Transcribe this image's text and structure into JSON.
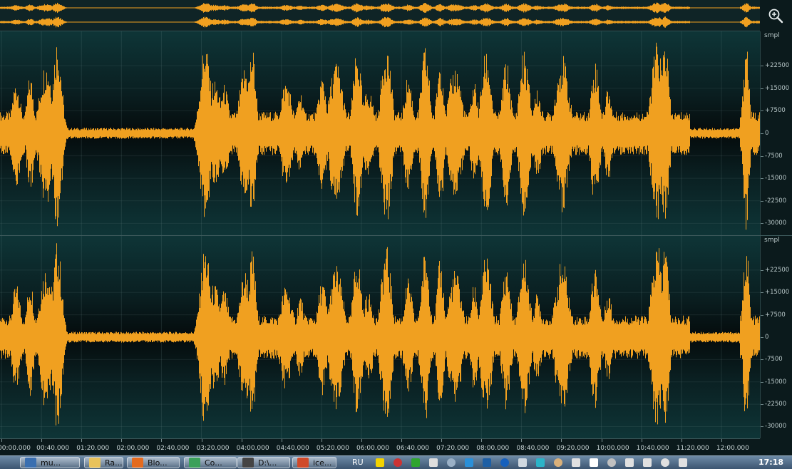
{
  "app": {
    "overview_icon": "zoom-in-icon",
    "amplitude_unit": "smpl",
    "waveform_color": "#f0a020",
    "amplitude_ticks": [
      "+22500",
      "+15000",
      "+7500",
      "0",
      "-7500",
      "-15000",
      "-22500",
      "-30000"
    ],
    "amplitude_values": [
      22500,
      15000,
      7500,
      0,
      -7500,
      -15000,
      -22500,
      -30000
    ],
    "amplitude_range": [
      -33000,
      33000
    ],
    "time_labels": [
      "00:00.000",
      "00:40.000",
      "01:20.000",
      "02:00.000",
      "02:40.000",
      "03:20.000",
      "04:00.000",
      "04:40.000",
      "05:20.000",
      "06:00.000",
      "06:40.000",
      "07:20.000",
      "08:00.000",
      "08:40.000",
      "09:20.000",
      "10:00.000",
      "10:40.000",
      "11:20.000",
      "12:00.000"
    ],
    "time_seconds": [
      0,
      40,
      80,
      120,
      160,
      200,
      240,
      280,
      320,
      360,
      400,
      440,
      480,
      520,
      560,
      600,
      640,
      680,
      720
    ],
    "duration_seconds": 753
  },
  "taskbar": {
    "buttons": [
      {
        "label": "mu...",
        "icon": "window-icon",
        "color": "#3a6fb0"
      },
      {
        "label": "Ra...",
        "icon": "folder-icon",
        "color": "#e8c25a"
      },
      {
        "label": "Blo...",
        "icon": "firefox-icon",
        "color": "#e46b1f"
      },
      {
        "label": "Co...",
        "icon": "chrome-icon",
        "color": "#3aa05a"
      },
      {
        "label": "D:\\...",
        "icon": "terminal-icon",
        "color": "#444444"
      },
      {
        "label": "ice...",
        "icon": "home-icon",
        "color": "#d04a2a"
      }
    ],
    "language": "RU",
    "tray_icons": [
      {
        "icon": "shield-icon",
        "color": "#f2d200"
      },
      {
        "icon": "pen-icon",
        "color": "#cc3333"
      },
      {
        "icon": "arrow-icon",
        "color": "#2fa52f"
      },
      {
        "icon": "gear-icon",
        "color": "#dddddd"
      },
      {
        "icon": "screen-icon",
        "color": "#9ab0c6"
      },
      {
        "icon": "s-icon",
        "color": "#2a8fd8"
      },
      {
        "icon": "bars-icon",
        "color": "#1d5fa5"
      },
      {
        "icon": "v-icon",
        "color": "#1560bd"
      },
      {
        "icon": "grid-icon",
        "color": "#cfd8e0"
      },
      {
        "icon": "chat-icon",
        "color": "#2bb3c8"
      },
      {
        "icon": "hand-icon",
        "color": "#d9b07a"
      },
      {
        "icon": "search-icon",
        "color": "#e0e0e0"
      },
      {
        "icon": "white-box-icon",
        "color": "#ffffff"
      },
      {
        "icon": "signal-icon",
        "color": "#c0c0c0"
      },
      {
        "icon": "flag-icon",
        "color": "#e0e0e0"
      },
      {
        "icon": "battery-icon",
        "color": "#e0e0e0"
      },
      {
        "icon": "network-icon",
        "color": "#e0e0e0"
      },
      {
        "icon": "volume-icon",
        "color": "#e0e0e0"
      }
    ],
    "clock": "17:18"
  }
}
